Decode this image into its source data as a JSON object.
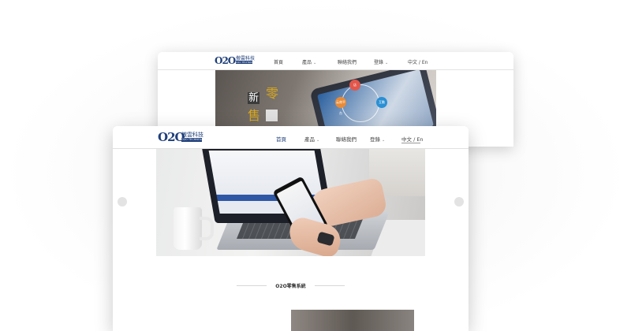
{
  "back_card": {
    "logo": {
      "mark": "O2O",
      "name": "傲雲科技",
      "sub": "O2O TECHNOLOGY"
    },
    "nav": [
      {
        "label": "首頁",
        "dropdown": false
      },
      {
        "label": "產品",
        "dropdown": true
      },
      {
        "label": "聯絡我們",
        "dropdown": false
      },
      {
        "label": "登錄",
        "dropdown": true
      },
      {
        "label": "中文 / En",
        "dropdown": false
      }
    ],
    "banner": {
      "chars": [
        "新",
        "零",
        "售"
      ],
      "bubbles": [
        "店",
        "云商平台",
        "互動"
      ]
    }
  },
  "front_card": {
    "logo": {
      "mark": "O2O",
      "name": "傲雲科技",
      "sub": "O2O TECHNOLOGY"
    },
    "nav": [
      {
        "label": "首頁",
        "dropdown": false,
        "active": true
      },
      {
        "label": "產品",
        "dropdown": true,
        "active": false
      },
      {
        "label": "聯絡我們",
        "dropdown": false,
        "active": false
      },
      {
        "label": "登錄",
        "dropdown": true,
        "active": false
      },
      {
        "label": "中文 / En",
        "dropdown": false,
        "active": false
      }
    ],
    "hero": {
      "slide_count": 2,
      "current_slide": 1
    },
    "section_title": "O2O零售系統"
  },
  "colors": {
    "brand": "#1f3f7a",
    "accent_gold": "#d9a81c"
  },
  "icons": {
    "prev": "chevron-left-icon",
    "next": "chevron-right-icon",
    "dropdown": "chevron-down-icon"
  }
}
